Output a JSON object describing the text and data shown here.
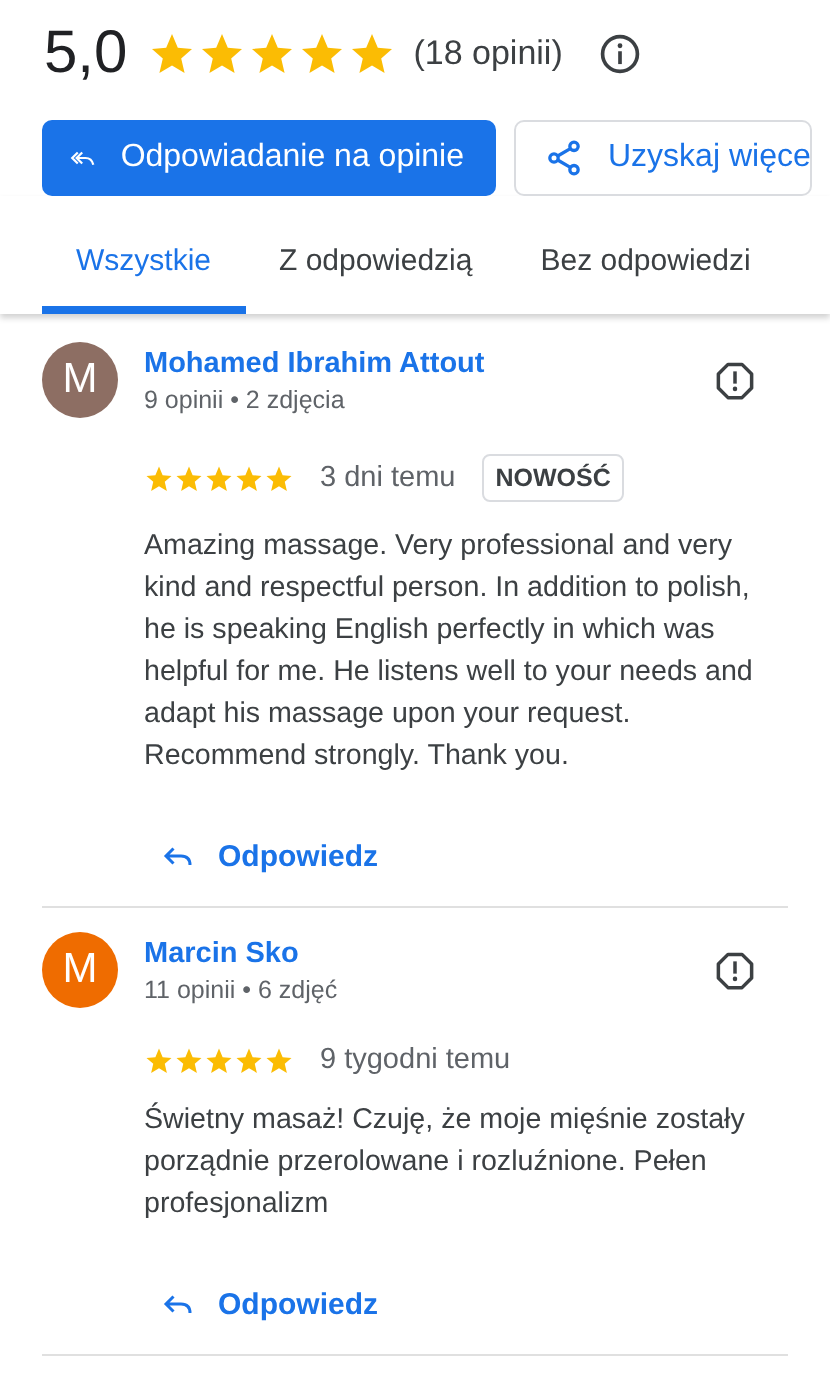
{
  "summary": {
    "rating": "5,0",
    "stars": 5,
    "count": "(18 opinii)"
  },
  "actions": [
    {
      "label": "Odpowiadanie na opinie",
      "kind": "primary"
    },
    {
      "label": "Uzyskaj więce",
      "kind": "share"
    }
  ],
  "tabs": [
    {
      "label": "Wszystkie",
      "selected": true
    },
    {
      "label": "Z odpowiedzią",
      "selected": false
    },
    {
      "label": "Bez odpowiedzi",
      "selected": false
    }
  ],
  "reviews": [
    {
      "initial": "M",
      "color": "#8d6e63",
      "name": "Mohamed Ibrahim Attout",
      "meta": "9 opinii • 2 zdjęcia",
      "stars": 5,
      "time": "3 dni temu",
      "badge": "NOWOŚĆ",
      "text": "Amazing massage. Very professional and very kind and respectful person. In addition to polish, he is speaking English perfectly in which was helpful for me. He listens well to your needs and adapt his massage upon your request. Recommend strongly. Thank you.",
      "reply": "Odpowiedz"
    },
    {
      "initial": "M",
      "color": "#ef6c00",
      "name": "Marcin Sko",
      "meta": "11 opinii • 6 zdjęć",
      "stars": 5,
      "time": "9 tygodni temu",
      "text": "Świetny masaż! Czuję, że moje mięśnie zostały porządnie przerolowane i rozluźnione. Pełen profesjonalizm",
      "reply": "Odpowiedz"
    }
  ]
}
